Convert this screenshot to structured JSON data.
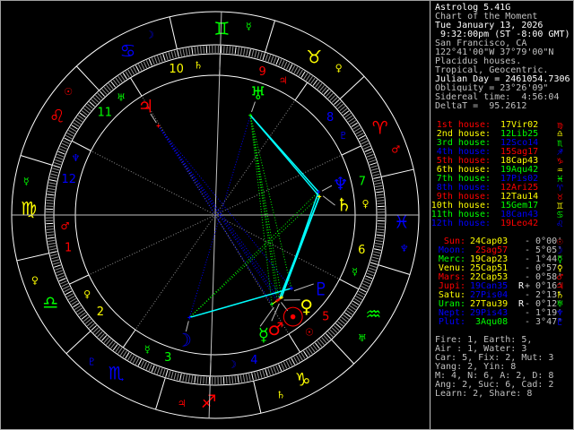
{
  "header": {
    "lines": [
      {
        "text": "Astrolog 5.41G",
        "color": "#ffffff"
      },
      {
        "text": "Chart of the Moment",
        "color": "#c0c0c0"
      },
      {
        "text": "Tue January 13, 2026",
        "color": "#ffffff"
      },
      {
        "text": " 9:32:00pm (ST -8:00 GMT)",
        "color": "#ffffff"
      },
      {
        "text": "San Francisco, CA",
        "color": "#c0c0c0"
      },
      {
        "text": "122°41'00\"W 37°79'00\"N",
        "color": "#c0c0c0"
      },
      {
        "text": "Placidus houses.",
        "color": "#c0c0c0"
      },
      {
        "text": "Tropical, Geocentric.",
        "color": "#c0c0c0"
      },
      {
        "text": "Julian Day = 2461054.7306",
        "color": "#ffffff"
      },
      {
        "text": "Obliquity = 23°26'09\"",
        "color": "#c0c0c0"
      },
      {
        "text": "Sidereal time:  4:56:04",
        "color": "#c0c0c0"
      },
      {
        "text": "DeltaT =  95.2612",
        "color": "#c0c0c0"
      }
    ]
  },
  "houses": [
    {
      "label": "1st house:",
      "pos": "17Vir02",
      "glyph": "♍",
      "color": "#ff0000",
      "pos_color": "#ffff00",
      "glyph_color": "#ff0000"
    },
    {
      "label": "2nd house:",
      "pos": "12Lib25",
      "glyph": "♎",
      "color": "#ffff00",
      "pos_color": "#00ff00",
      "glyph_color": "#ffff00"
    },
    {
      "label": "3rd house:",
      "pos": "12Sco14",
      "glyph": "♏",
      "color": "#00ff00",
      "pos_color": "#0000ff",
      "glyph_color": "#00ff00"
    },
    {
      "label": "4th house:",
      "pos": "15Sag17",
      "glyph": "♐",
      "color": "#0000ff",
      "pos_color": "#ff0000",
      "glyph_color": "#0000ff"
    },
    {
      "label": "5th house:",
      "pos": "18Cap43",
      "glyph": "♑",
      "color": "#ff0000",
      "pos_color": "#ffff00",
      "glyph_color": "#ff0000"
    },
    {
      "label": "6th house:",
      "pos": "19Aqu42",
      "glyph": "♒",
      "color": "#ffff00",
      "pos_color": "#00ff00",
      "glyph_color": "#ffff00"
    },
    {
      "label": "7th house:",
      "pos": "17Pis02",
      "glyph": "♓",
      "color": "#00ff00",
      "pos_color": "#0000ff",
      "glyph_color": "#00ff00"
    },
    {
      "label": "8th house:",
      "pos": "12Ari25",
      "glyph": "♈",
      "color": "#0000ff",
      "pos_color": "#ff0000",
      "glyph_color": "#0000ff"
    },
    {
      "label": "9th house:",
      "pos": "12Tau14",
      "glyph": "♉",
      "color": "#ff0000",
      "pos_color": "#ffff00",
      "glyph_color": "#ff0000"
    },
    {
      "label": "10th house:",
      "pos": "15Gem17",
      "glyph": "♊",
      "color": "#ffff00",
      "pos_color": "#00ff00",
      "glyph_color": "#ffff00"
    },
    {
      "label": "11th house:",
      "pos": "18Can43",
      "glyph": "♋",
      "color": "#00ff00",
      "pos_color": "#0000ff",
      "glyph_color": "#00ff00"
    },
    {
      "label": "12th house:",
      "pos": "19Leo42",
      "glyph": "♌",
      "color": "#0000ff",
      "pos_color": "#ff0000",
      "glyph_color": "#0000ff"
    }
  ],
  "planets": [
    {
      "key": "sun",
      "name": "Sun:",
      "pos": "24Cap03",
      "retro": "",
      "dev": "- 0°00'",
      "glyph": "☉",
      "color": "#ff0000",
      "pos_color": "#ffff00"
    },
    {
      "key": "moon",
      "name": "Moon:",
      "pos": " 2Sag57",
      "retro": "",
      "dev": "- 5°05'",
      "glyph": "☽",
      "color": "#0000ff",
      "pos_color": "#ff0000"
    },
    {
      "key": "mercury",
      "name": "Merc:",
      "pos": "19Cap23",
      "retro": "",
      "dev": "- 1°44'",
      "glyph": "☿",
      "color": "#00ff00",
      "pos_color": "#ffff00"
    },
    {
      "key": "venus",
      "name": "Venu:",
      "pos": "25Cap51",
      "retro": "",
      "dev": "- 0°57'",
      "glyph": "♀",
      "color": "#ffff00",
      "pos_color": "#ffff00"
    },
    {
      "key": "mars",
      "name": "Mars:",
      "pos": "22Cap53",
      "retro": "",
      "dev": "- 0°58'",
      "glyph": "♂",
      "color": "#ff0000",
      "pos_color": "#ffff00"
    },
    {
      "key": "jupiter",
      "name": "Jupi:",
      "pos": "19Can35",
      "retro": "R",
      "dev": "+ 0°16'",
      "glyph": "♃",
      "color": "#ff0000",
      "pos_color": "#0000ff"
    },
    {
      "key": "saturn",
      "name": "Satu:",
      "pos": "27Pis04",
      "retro": "",
      "dev": "- 2°13'",
      "glyph": "♄",
      "color": "#ffff00",
      "pos_color": "#0000ff"
    },
    {
      "key": "uranus",
      "name": "Uran:",
      "pos": "27Tau39",
      "retro": "R",
      "dev": "- 0°12'",
      "glyph": "♅",
      "color": "#00ff00",
      "pos_color": "#ffff00"
    },
    {
      "key": "neptune",
      "name": "Nept:",
      "pos": "29Pis43",
      "retro": "",
      "dev": "- 1°19'",
      "glyph": "♆",
      "color": "#0000ff",
      "pos_color": "#0000ff"
    },
    {
      "key": "pluto",
      "name": "Plut:",
      "pos": " 3Aqu08",
      "retro": "",
      "dev": "- 3°47'",
      "glyph": "♇",
      "color": "#0000ff",
      "pos_color": "#00ff00"
    }
  ],
  "summary": [
    "Fire: 1, Earth: 5,",
    "Air : 1, Water: 3",
    "Car: 5, Fix: 2, Mut: 3",
    "Yang: 2, Yin: 8",
    "M: 4, N: 6, A: 2, D: 8",
    "Ang: 2, Suc: 6, Cad: 2",
    "Learn: 2, Share: 8"
  ],
  "wheel": {
    "signs": [
      {
        "glyph": "♈",
        "ruler": "♂",
        "color": "#ff0000",
        "ruler_color": "#ff0000"
      },
      {
        "glyph": "♉",
        "ruler": "♀",
        "color": "#ffff00",
        "ruler_color": "#ffff00"
      },
      {
        "glyph": "♊",
        "ruler": "☿",
        "color": "#00ff00",
        "ruler_color": "#00ff00"
      },
      {
        "glyph": "♋",
        "ruler": "☽",
        "color": "#0000ff",
        "ruler_color": "#0000ff"
      },
      {
        "glyph": "♌",
        "ruler": "☉",
        "color": "#ff0000",
        "ruler_color": "#ff0000"
      },
      {
        "glyph": "♍",
        "ruler": "☿",
        "color": "#ffff00",
        "ruler_color": "#00ff00"
      },
      {
        "glyph": "♎",
        "ruler": "♀",
        "color": "#00ff00",
        "ruler_color": "#ffff00"
      },
      {
        "glyph": "♏",
        "ruler": "♇",
        "color": "#0000ff",
        "ruler_color": "#0000ff"
      },
      {
        "glyph": "♐",
        "ruler": "♃",
        "color": "#ff0000",
        "ruler_color": "#ff0000"
      },
      {
        "glyph": "♑",
        "ruler": "♄",
        "color": "#ffff00",
        "ruler_color": "#ffff00"
      },
      {
        "glyph": "♒",
        "ruler": "♅",
        "color": "#00ff00",
        "ruler_color": "#00ff00"
      },
      {
        "glyph": "♓",
        "ruler": "♆",
        "color": "#0000ff",
        "ruler_color": "#0000ff"
      }
    ],
    "house_numbers": [
      "1",
      "2",
      "3",
      "4",
      "5",
      "6",
      "7",
      "8",
      "9",
      "10",
      "11",
      "12"
    ],
    "house_rulers": [
      {
        "glyph": "♂",
        "color": "#ff0000"
      },
      {
        "glyph": "♀",
        "color": "#ffff00"
      },
      {
        "glyph": "☿",
        "color": "#00ff00"
      },
      {
        "glyph": "☽",
        "color": "#0000ff"
      },
      {
        "glyph": "☉",
        "color": "#ff0000"
      },
      {
        "glyph": "☿",
        "color": "#00ff00"
      },
      {
        "glyph": "♀",
        "color": "#ffff00"
      },
      {
        "glyph": "♇",
        "color": "#0000ff"
      },
      {
        "glyph": "♃",
        "color": "#ff0000"
      },
      {
        "glyph": "♄",
        "color": "#ffff00"
      },
      {
        "glyph": "♅",
        "color": "#00ff00"
      },
      {
        "glyph": "♆",
        "color": "#0000ff"
      }
    ],
    "aspect_colors": {
      "opp": "#0000ff",
      "tri": "#00ff00",
      "sex": "#00ffff",
      "con": "#ffff00"
    },
    "aspects": [
      [
        "jupiter",
        "sun",
        "opp"
      ],
      [
        "jupiter",
        "venus",
        "opp"
      ],
      [
        "jupiter",
        "mars",
        "opp"
      ],
      [
        "jupiter",
        "mercury",
        "opp"
      ],
      [
        "jupiter",
        "pluto",
        "opp"
      ],
      [
        "uranus",
        "moon",
        "opp"
      ],
      [
        "uranus",
        "mercury",
        "tri"
      ],
      [
        "uranus",
        "sun",
        "tri"
      ],
      [
        "uranus",
        "mars",
        "tri"
      ],
      [
        "uranus",
        "venus",
        "tri"
      ],
      [
        "uranus",
        "pluto",
        "tri"
      ],
      [
        "saturn",
        "moon",
        "tri"
      ],
      [
        "neptune",
        "moon",
        "tri"
      ],
      [
        "uranus",
        "saturn",
        "sex"
      ],
      [
        "uranus",
        "neptune",
        "sex"
      ],
      [
        "saturn",
        "sun",
        "sex"
      ],
      [
        "saturn",
        "venus",
        "sex"
      ],
      [
        "neptune",
        "venus",
        "sex"
      ],
      [
        "moon",
        "pluto",
        "sex"
      ],
      [
        "sun",
        "venus",
        "con"
      ],
      [
        "sun",
        "mars",
        "con"
      ],
      [
        "mercury",
        "mars",
        "con"
      ]
    ]
  }
}
